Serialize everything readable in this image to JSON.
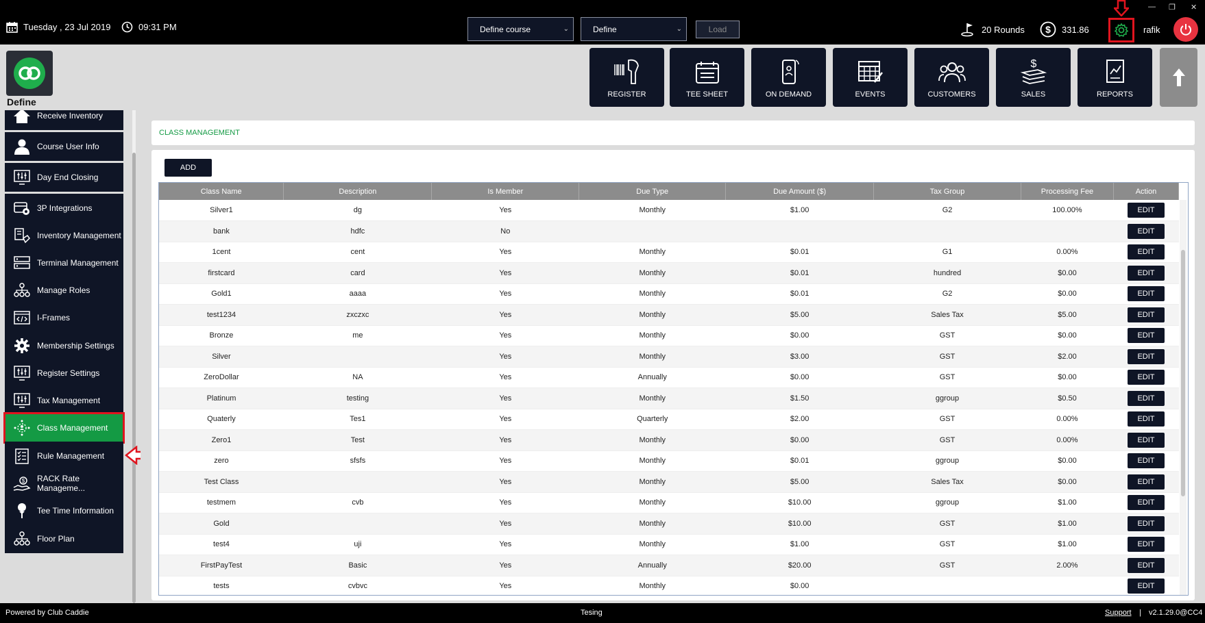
{
  "topbar": {
    "date": "Tuesday ,  23 Jul 2019",
    "time": "09:31 PM",
    "course_select": "Define course",
    "define_select": "Define",
    "load_label": "Load",
    "rounds": "20 Rounds",
    "balance": "331.86",
    "username": "rafik"
  },
  "header": {
    "logo_label": "Define",
    "nav": [
      {
        "label": "REGISTER",
        "icon": "barcode-scanner-icon"
      },
      {
        "label": "TEE SHEET",
        "icon": "calendar-icon"
      },
      {
        "label": "ON DEMAND",
        "icon": "mobile-icon"
      },
      {
        "label": "EVENTS",
        "icon": "events-calendar-icon"
      },
      {
        "label": "CUSTOMERS",
        "icon": "users-icon"
      },
      {
        "label": "SALES",
        "icon": "money-icon"
      },
      {
        "label": "REPORTS",
        "icon": "report-icon"
      }
    ]
  },
  "sidebar": {
    "items": [
      {
        "label": "Receive Inventory",
        "icon": "home-icon"
      },
      {
        "label": "Course User Info",
        "icon": "user-icon"
      },
      {
        "label": "Day End Closing",
        "icon": "monitor-sliders-icon"
      },
      {
        "label": "3P Integrations",
        "icon": "integration-icon"
      },
      {
        "label": "Inventory Management",
        "icon": "inventory-icon"
      },
      {
        "label": "Terminal Management",
        "icon": "terminal-icon"
      },
      {
        "label": "Manage Roles",
        "icon": "roles-icon"
      },
      {
        "label": "I-Frames",
        "icon": "code-icon"
      },
      {
        "label": "Membership Settings",
        "icon": "gear-icon"
      },
      {
        "label": "Register Settings",
        "icon": "monitor-sliders-icon"
      },
      {
        "label": "Tax Management",
        "icon": "monitor-sliders-icon"
      },
      {
        "label": "Class Management",
        "icon": "class-icon"
      },
      {
        "label": "Rule Management",
        "icon": "checklist-icon"
      },
      {
        "label": "RACK Rate Manageme...",
        "icon": "hand-money-icon"
      },
      {
        "label": "Tee Time Information",
        "icon": "golf-tee-icon"
      },
      {
        "label": "Floor Plan",
        "icon": "floor-plan-icon"
      }
    ]
  },
  "main": {
    "breadcrumb": "CLASS MANAGEMENT",
    "add_label": "ADD",
    "edit_label": "EDIT",
    "columns": [
      "Class Name",
      "Description",
      "Is Member",
      "Due Type",
      "Due Amount ($)",
      "Tax Group",
      "Processing Fee",
      "Action"
    ],
    "rows": [
      [
        "Silver1",
        "dg",
        "Yes",
        "Monthly",
        "$1.00",
        "G2",
        "100.00%"
      ],
      [
        "bank",
        "hdfc",
        "No",
        "",
        "",
        "",
        ""
      ],
      [
        "1cent",
        "cent",
        "Yes",
        "Monthly",
        "$0.01",
        "G1",
        "0.00%"
      ],
      [
        "firstcard",
        "card",
        "Yes",
        "Monthly",
        "$0.01",
        "hundred",
        "$0.00"
      ],
      [
        "Gold1",
        "aaaa",
        "Yes",
        "Monthly",
        "$0.01",
        "G2",
        "$0.00"
      ],
      [
        "test1234",
        "zxczxc",
        "Yes",
        "Monthly",
        "$5.00",
        "Sales Tax",
        "$5.00"
      ],
      [
        "Bronze",
        "me",
        "Yes",
        "Monthly",
        "$0.00",
        "GST",
        "$0.00"
      ],
      [
        "Silver",
        "",
        "Yes",
        "Monthly",
        "$3.00",
        "GST",
        "$2.00"
      ],
      [
        "ZeroDollar",
        "NA",
        "Yes",
        "Annually",
        "$0.00",
        "GST",
        "$0.00"
      ],
      [
        "Platinum",
        "testing",
        "Yes",
        "Monthly",
        "$1.50",
        "ggroup",
        "$0.50"
      ],
      [
        "Quaterly",
        "Tes1",
        "Yes",
        "Quarterly",
        "$2.00",
        "GST",
        "0.00%"
      ],
      [
        "Zero1",
        "Test",
        "Yes",
        "Monthly",
        "$0.00",
        "GST",
        "0.00%"
      ],
      [
        "zero",
        "sfsfs",
        "Yes",
        "Monthly",
        "$0.01",
        "ggroup",
        "$0.00"
      ],
      [
        "Test Class",
        "",
        "Yes",
        "Monthly",
        "$5.00",
        "Sales Tax",
        "$0.00"
      ],
      [
        "testmem",
        "cvb",
        "Yes",
        "Monthly",
        "$10.00",
        "ggroup",
        "$1.00"
      ],
      [
        "Gold",
        "",
        "Yes",
        "Monthly",
        "$10.00",
        "GST",
        "$1.00"
      ],
      [
        "test4",
        "uji",
        "Yes",
        "Monthly",
        "$1.00",
        "GST",
        "$1.00"
      ],
      [
        "FirstPayTest",
        "Basic",
        "Yes",
        "Annually",
        "$20.00",
        "GST",
        "2.00%"
      ],
      [
        "tests",
        "cvbvc",
        "Yes",
        "Monthly",
        "$0.00",
        "",
        ""
      ]
    ]
  },
  "footer": {
    "powered": "Powered by Club Caddie",
    "center": "Tesing",
    "support": "Support",
    "separator": "|",
    "version": "v2.1.29.0@CC4"
  },
  "colors": {
    "navy": "#0f1526",
    "green": "#149a44",
    "highlight_red": "#e0141e",
    "power_red": "#e83340"
  }
}
